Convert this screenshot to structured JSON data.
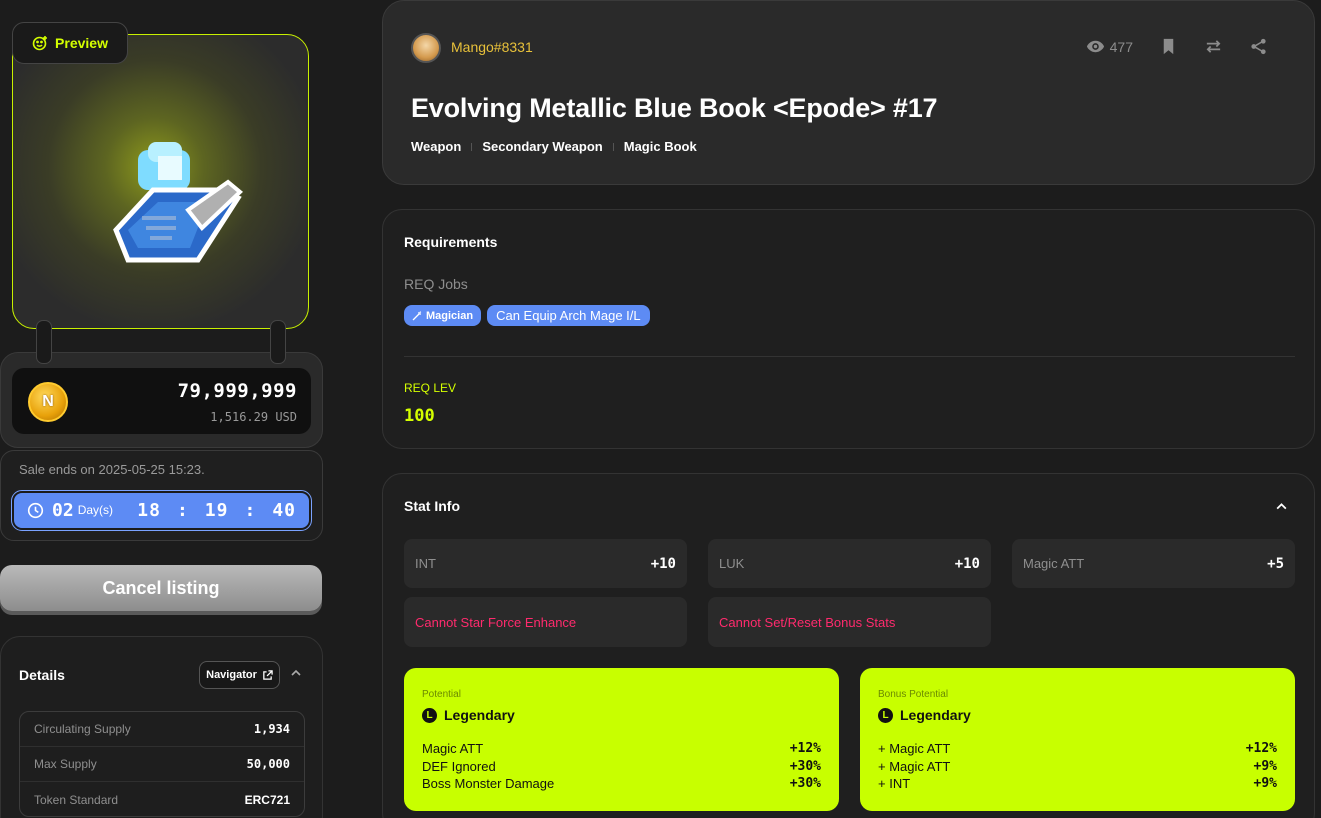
{
  "preview": {
    "label": "Preview"
  },
  "price": {
    "amount": "79,999,999",
    "usd": "1,516.29 USD",
    "coin_symbol": "N"
  },
  "sale": {
    "ends_text": "Sale ends on 2025-05-25 15:23.",
    "days": "02",
    "days_label": "Day(s)",
    "hours": "18",
    "minutes": "19",
    "seconds": "40",
    "sep": ":"
  },
  "cancel_label": "Cancel listing",
  "details": {
    "title": "Details",
    "navigator_label": "Navigator",
    "rows": [
      {
        "key": "Circulating Supply",
        "value": "1,934"
      },
      {
        "key": "Max Supply",
        "value": "50,000"
      },
      {
        "key": "Token Standard",
        "value": "ERC721"
      }
    ]
  },
  "header": {
    "seller": "Mango#8331",
    "views": "477",
    "title": "Evolving Metallic Blue Book <Epode> #17",
    "crumbs": [
      "Weapon",
      "Secondary Weapon",
      "Magic Book"
    ]
  },
  "requirements": {
    "title": "Requirements",
    "jobs_label": "REQ Jobs",
    "job_badge": "Magician",
    "job_note": "Can Equip Arch Mage I/L",
    "lev_label": "REQ LEV",
    "lev_value": "100"
  },
  "stats": {
    "title": "Stat Info",
    "cells": [
      {
        "key": "INT",
        "value": "+10"
      },
      {
        "key": "LUK",
        "value": "+10"
      },
      {
        "key": "Magic ATT",
        "value": "+5"
      }
    ],
    "warnings": [
      "Cannot Star Force Enhance",
      "Cannot Set/Reset Bonus Stats"
    ],
    "potential": {
      "label": "Potential",
      "grade": "Legendary",
      "grade_icon": "L",
      "lines": [
        {
          "key": "Magic ATT",
          "value": "+12%"
        },
        {
          "key": "DEF Ignored",
          "value": "+30%"
        },
        {
          "key": "Boss Monster Damage",
          "value": "+30%"
        }
      ]
    },
    "bonus_potential": {
      "label": "Bonus Potential",
      "grade": "Legendary",
      "grade_icon": "L",
      "lines": [
        {
          "key": "+ Magic ATT",
          "value": "+12%"
        },
        {
          "key": "+ Magic ATT",
          "value": "+9%"
        },
        {
          "key": "+ INT",
          "value": "+9%"
        }
      ]
    }
  },
  "colors": {
    "accent": "#c8ff00",
    "timer_blue": "#5d8bf4",
    "warning": "#ff2a6d",
    "seller": "#e8c13a"
  }
}
